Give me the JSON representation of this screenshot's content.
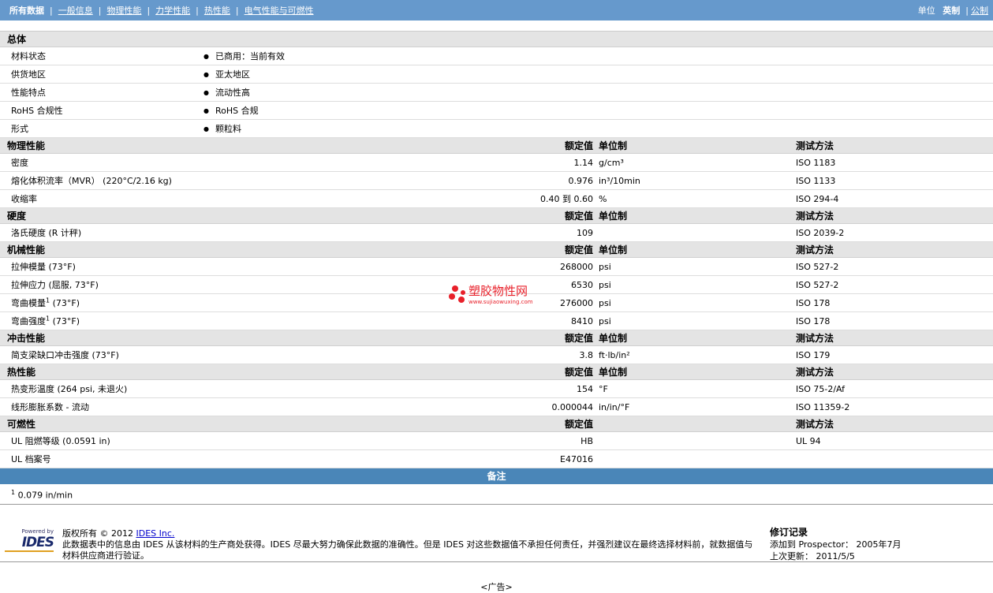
{
  "nav": {
    "items": [
      "所有数据",
      "一般信息",
      "物理性能",
      "力学性能",
      "热性能",
      "电气性能与可燃性"
    ],
    "unit_label": "单位",
    "unit_active": "英制",
    "unit_other": "公制"
  },
  "cols": {
    "value": "额定值",
    "unit": "单位制",
    "method": "测试方法"
  },
  "general": {
    "title": "总体",
    "rows": [
      {
        "label": "材料状态",
        "value": "已商用：当前有效"
      },
      {
        "label": "供货地区",
        "value": "亚太地区"
      },
      {
        "label": "性能特点",
        "value": "流动性高"
      },
      {
        "label": "RoHS 合规性",
        "value": "RoHS 合规"
      },
      {
        "label": "形式",
        "value": "颗粒料"
      }
    ]
  },
  "sections": [
    {
      "title": "物理性能",
      "rows": [
        {
          "label": "密度",
          "value": "1.14",
          "unit": "g/cm³",
          "method": "ISO 1183"
        },
        {
          "label": "熔化体积流率（MVR） (220°C/2.16 kg)",
          "value": "0.976",
          "unit": "in³/10min",
          "method": "ISO 1133"
        },
        {
          "label": "收缩率",
          "value": "0.40 到  0.60",
          "unit": "%",
          "method": "ISO 294-4"
        }
      ]
    },
    {
      "title": "硬度",
      "rows": [
        {
          "label": "洛氏硬度 (R 计秤)",
          "value": "109",
          "unit": "",
          "method": "ISO 2039-2"
        }
      ]
    },
    {
      "title": "机械性能",
      "rows": [
        {
          "label": "拉伸模量 (73°F)",
          "value": "268000",
          "unit": "psi",
          "method": "ISO 527-2"
        },
        {
          "label": "拉伸应力 (屈服, 73°F)",
          "value": "6530",
          "unit": "psi",
          "method": "ISO 527-2"
        },
        {
          "label": "弯曲模量",
          "sup": "1",
          "label2": " (73°F)",
          "value": "276000",
          "unit": "psi",
          "method": "ISO 178"
        },
        {
          "label": "弯曲强度",
          "sup": "1",
          "label2": " (73°F)",
          "value": "8410",
          "unit": "psi",
          "method": "ISO 178"
        }
      ]
    },
    {
      "title": "冲击性能",
      "rows": [
        {
          "label": "简支梁缺口冲击强度 (73°F)",
          "value": "3.8",
          "unit": "ft·lb/in²",
          "method": "ISO 179"
        }
      ]
    },
    {
      "title": "热性能",
      "rows": [
        {
          "label": "热变形温度 (264 psi, 未退火)",
          "value": "154",
          "unit": "°F",
          "method": "ISO 75-2/Af"
        },
        {
          "label": "线形膨胀系数 - 流动",
          "value": "0.000044",
          "unit": "in/in/°F",
          "method": "ISO 11359-2"
        }
      ]
    },
    {
      "title": "可燃性",
      "nounit": true,
      "rows": [
        {
          "label": "UL 阻燃等级 (0.0591 in)",
          "value": "HB",
          "unit": "",
          "method": "UL 94"
        },
        {
          "label": "UL 档案号",
          "value": "E47016",
          "unit": "",
          "method": ""
        }
      ]
    }
  ],
  "notes": {
    "title": "备注",
    "items": [
      {
        "num": "1",
        "text": "0.079 in/min"
      }
    ]
  },
  "footer": {
    "logo_small": "Powered by",
    "logo": "IDES",
    "copyright": "版权所有 © 2012",
    "company": "IDES Inc.",
    "disclaimer": "此数据表中的信息由 IDES 从该材料的生产商处获得。IDES 尽最大努力确保此数据的准确性。但是 IDES 对这些数据值不承担任何责任，并强烈建议在最终选择材料前，就数据值与材料供应商进行验证。",
    "rev_title": "修订记录",
    "added": "添加到 Prospector： 2005年7月",
    "updated": "上次更新： 2011/5/5"
  },
  "ad": "<广告>",
  "watermark": {
    "title": "塑胶物性网",
    "url": "www.sujiaowuxing.com"
  }
}
